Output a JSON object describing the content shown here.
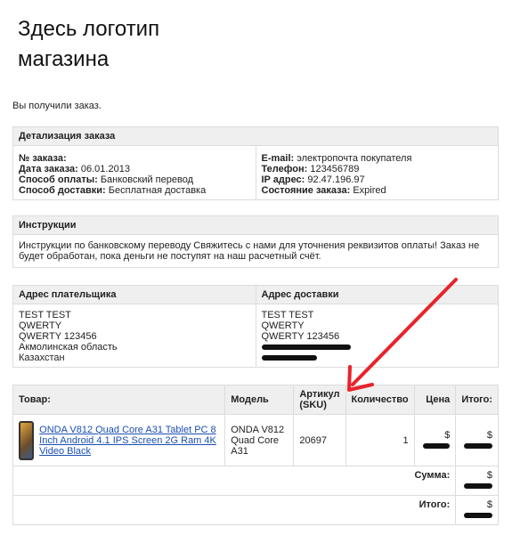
{
  "logo": {
    "line1": "Здесь логотип",
    "line2": "магазина"
  },
  "received": "Вы получили заказ.",
  "details": {
    "header": "Детализация заказа",
    "left": [
      {
        "label": "№ заказа:",
        "value": ""
      },
      {
        "label": "Дата заказа:",
        "value": "06.01.2013"
      },
      {
        "label": "Способ оплаты:",
        "value": "Банковский перевод"
      },
      {
        "label": "Способ доставки:",
        "value": "Бесплатная доставка"
      }
    ],
    "right": [
      {
        "label": "E-mail:",
        "value": "электропочта покупателя"
      },
      {
        "label": "Телефон:",
        "value": "123456789"
      },
      {
        "label": "IP адрес:",
        "value": "92.47.196.97"
      },
      {
        "label": "Состояние заказа:",
        "value": "Expired"
      }
    ]
  },
  "instructions": {
    "header": "Инструкции",
    "text": "Инструкции по банковскому переводу Свяжитесь с нами для уточнения реквизитов оплаты! Заказ не будет обработан, пока деньги не поступят на наш расчетный счёт."
  },
  "addresses": {
    "payer_header": "Адрес плательщика",
    "shipping_header": "Адрес доставки",
    "payer": [
      "TEST TEST",
      "QWERTY",
      "QWERTY 123456",
      "Акмолинская область",
      "Казахстан"
    ],
    "shipping": [
      "TEST TEST",
      "QWERTY",
      "QWERTY 123456"
    ]
  },
  "products": {
    "columns": {
      "product": "Товар:",
      "model": "Модель",
      "sku": "Артикул (SKU)",
      "qty": "Количество",
      "price": "Цена",
      "total": "Итого:"
    },
    "item": {
      "name": "ONDA V812 Quad Core A31 Tablet PC 8 Inch Android 4.1 IPS Screen 2G Ram 4K Video Black",
      "model": "ONDA V812 Quad Core A31",
      "sku": "20697",
      "qty": "1",
      "price": "$",
      "total": "$"
    },
    "subtotal_label": "Сумма:",
    "subtotal_value": "$",
    "grand_label": "Итого:",
    "grand_value": "$"
  },
  "colors": {
    "annotation_arrow": "#e8232b",
    "link": "#1a4fb4",
    "header_bg": "#efefef"
  }
}
